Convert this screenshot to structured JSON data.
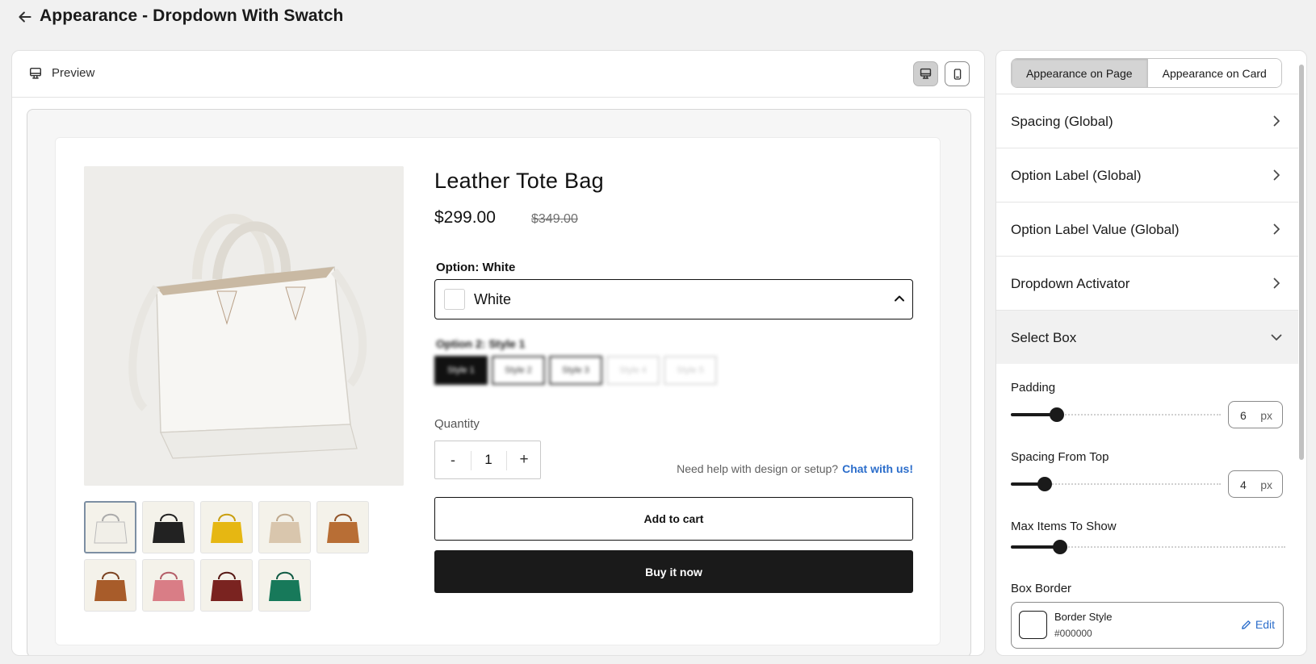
{
  "header": {
    "title": "Appearance - Dropdown With Swatch"
  },
  "preview": {
    "label": "Preview",
    "device_active": "desktop",
    "product": {
      "title": "Leather Tote Bag",
      "price": "$299.00",
      "compare_price": "$349.00",
      "option1_label": "Option: White",
      "option1_value": "White",
      "option1_swatch_color": "#ffffff",
      "option2_label": "Option 2: Style 1",
      "option2_values": [
        "Style 1",
        "Style 2",
        "Style 3",
        "Style 4",
        "Style 5"
      ],
      "quantity_label": "Quantity",
      "quantity_minus": "-",
      "quantity_value": "1",
      "quantity_plus": "+",
      "help_text": "Need help with design or setup?",
      "help_link": "Chat with us!",
      "add_to_cart": "Add to cart",
      "buy_now": "Buy it now",
      "thumbnail_colors": [
        "#f1efe8",
        "#222222",
        "#e6b712",
        "#d9c6ad",
        "#b86e35",
        "#a85c2a",
        "#d97d86",
        "#7a2320",
        "#17795a"
      ]
    }
  },
  "settings": {
    "tabs": [
      "Appearance on Page",
      "Appearance on Card"
    ],
    "active_tab": "Appearance on Page",
    "sections": [
      "Spacing (Global)",
      "Option Label (Global)",
      "Option Label Value (Global)",
      "Dropdown Activator",
      "Select Box"
    ],
    "expanded_section": "Select Box",
    "controls": {
      "padding": {
        "label": "Padding",
        "value": "6",
        "unit": "px",
        "fraction": 0.22
      },
      "spacing_top": {
        "label": "Spacing From Top",
        "value": "4",
        "unit": "px",
        "fraction": 0.16
      },
      "max_items": {
        "label": "Max Items To Show",
        "fraction": 0.18
      },
      "box_border": {
        "label": "Box Border",
        "style_title": "Border Style",
        "color": "#000000",
        "edit": "Edit"
      }
    }
  },
  "colors": {
    "accent_blue": "#2c6ecb",
    "button_dark": "#1a1a1a"
  }
}
